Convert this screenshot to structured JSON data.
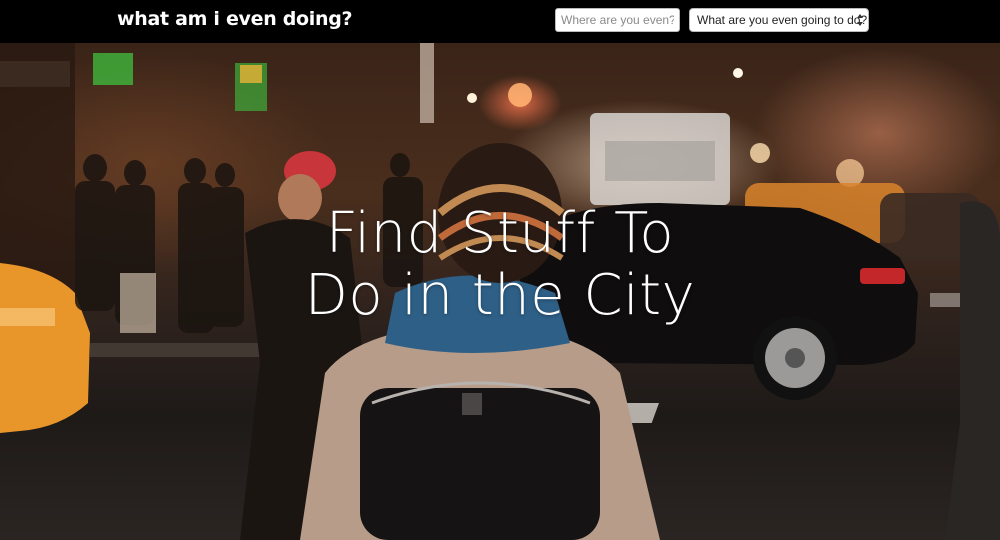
{
  "header": {
    "brand": "what am i even doing?",
    "location_input": {
      "value": "",
      "placeholder": "Where are you even?"
    },
    "activity_select": {
      "selected": "What are you even going to do?"
    }
  },
  "hero": {
    "title_line_1": "Find Stuff To",
    "title_line_2": "Do in the City",
    "background_description": "night city street scene"
  },
  "colors": {
    "topbar": "#000000",
    "text": "#ffffff",
    "taxi": "#e8962a"
  }
}
